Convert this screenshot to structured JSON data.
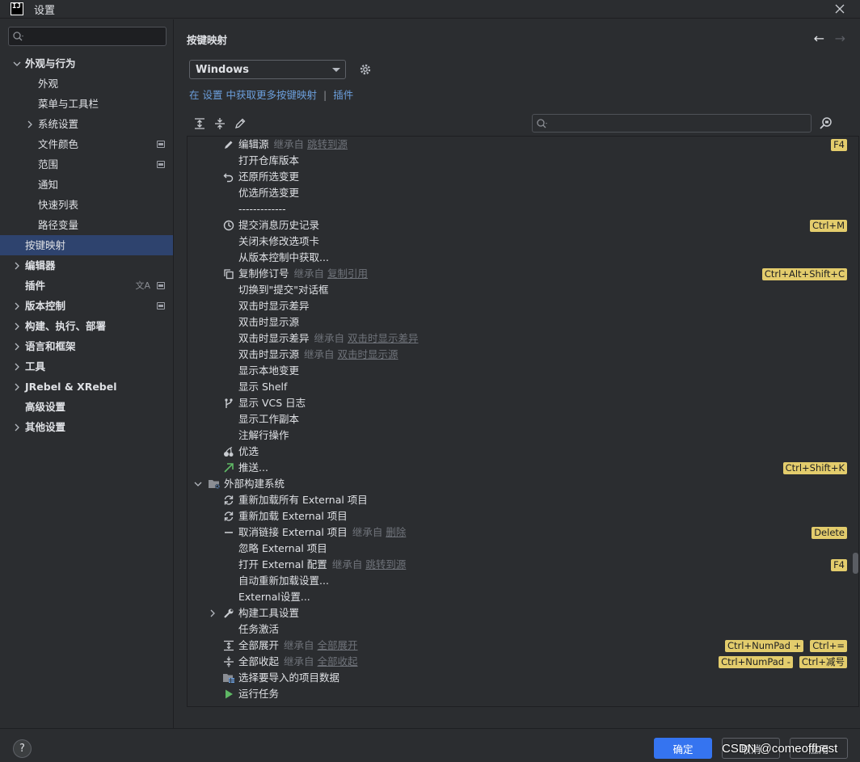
{
  "window": {
    "title": "设置",
    "logo": "IJ"
  },
  "sidebar": {
    "search_placeholder": "",
    "items": [
      {
        "label": "外观与行为"
      },
      {
        "label": "外观"
      },
      {
        "label": "菜单与工具栏"
      },
      {
        "label": "系统设置"
      },
      {
        "label": "文件颜色"
      },
      {
        "label": "范围"
      },
      {
        "label": "通知"
      },
      {
        "label": "快速列表"
      },
      {
        "label": "路径变量"
      },
      {
        "label": "按键映射"
      },
      {
        "label": "编辑器"
      },
      {
        "label": "插件"
      },
      {
        "label": "版本控制"
      },
      {
        "label": "构建、执行、部署"
      },
      {
        "label": "语言和框架"
      },
      {
        "label": "工具"
      },
      {
        "label": "JRebel & XRebel"
      },
      {
        "label": "高级设置"
      },
      {
        "label": "其他设置"
      }
    ]
  },
  "main": {
    "title": "按键映射",
    "keymap_selected": "Windows",
    "plugin_line": {
      "prefix": "在",
      "settings": "设置",
      "middle": "中获取更多按键映射",
      "separator": "|",
      "plugins": "插件"
    },
    "search_placeholder": ""
  },
  "actions": [
    {
      "label": "编辑源",
      "icon": "pencil-icon",
      "inherit": "继承自",
      "source": "跳转到源",
      "shortcuts": [
        "F4"
      ]
    },
    {
      "label": "打开仓库版本",
      "icon": "",
      "shortcuts": []
    },
    {
      "label": "还原所选变更",
      "icon": "undo-icon",
      "shortcuts": []
    },
    {
      "label": "优选所选变更",
      "icon": "",
      "shortcuts": []
    },
    {
      "label": "-------------",
      "icon": "",
      "shortcuts": []
    },
    {
      "label": "提交消息历史记录",
      "icon": "clock-icon",
      "shortcuts": [
        "Ctrl+M"
      ]
    },
    {
      "label": "关闭未修改选项卡",
      "icon": "",
      "shortcuts": []
    },
    {
      "label": "从版本控制中获取...",
      "icon": "",
      "shortcuts": []
    },
    {
      "label": "复制修订号",
      "icon": "copy-icon",
      "inherit": "继承自",
      "source": "复制引用",
      "shortcuts": [
        "Ctrl+Alt+Shift+C"
      ]
    },
    {
      "label": "切换到\"提交\"对话框",
      "icon": "",
      "shortcuts": []
    },
    {
      "label": "双击时显示差异",
      "icon": "",
      "shortcuts": []
    },
    {
      "label": "双击时显示源",
      "icon": "",
      "shortcuts": []
    },
    {
      "label": "双击时显示差异",
      "icon": "",
      "inherit": "继承自",
      "source": "双击时显示差异",
      "shortcuts": []
    },
    {
      "label": "双击时显示源",
      "icon": "",
      "inherit": "继承自",
      "source": "双击时显示源",
      "shortcuts": []
    },
    {
      "label": "显示本地变更",
      "icon": "",
      "shortcuts": []
    },
    {
      "label": "显示 Shelf",
      "icon": "",
      "shortcuts": []
    },
    {
      "label": "显示 VCS 日志",
      "icon": "branch-icon",
      "shortcuts": []
    },
    {
      "label": "显示工作副本",
      "icon": "",
      "shortcuts": []
    },
    {
      "label": "注解行操作",
      "icon": "",
      "shortcuts": []
    },
    {
      "label": "优选",
      "icon": "cherry-icon",
      "shortcuts": []
    },
    {
      "label": "推送...",
      "icon": "push-arrow-icon",
      "shortcuts": [
        "Ctrl+Shift+K"
      ]
    },
    {
      "label": "外部构建系统",
      "icon": "folder-gear-icon",
      "folder": true,
      "expanded": true,
      "shortcuts": []
    },
    {
      "label": "重新加载所有 External 项目",
      "icon": "refresh-icon",
      "shortcuts": []
    },
    {
      "label": "重新加载 External 项目",
      "icon": "refresh-icon",
      "shortcuts": []
    },
    {
      "label": "取消链接 External 项目",
      "icon": "minus-icon",
      "inherit": "继承自",
      "source": "删除",
      "shortcuts": [
        "Delete"
      ]
    },
    {
      "label": "忽略 External 项目",
      "icon": "",
      "shortcuts": []
    },
    {
      "label": "打开 External 配置",
      "icon": "",
      "inherit": "继承自",
      "source": "跳转到源",
      "shortcuts": [
        "F4"
      ]
    },
    {
      "label": "自动重新加载设置...",
      "icon": "",
      "shortcuts": []
    },
    {
      "label": "External设置...",
      "icon": "",
      "shortcuts": []
    },
    {
      "label": "构建工具设置",
      "icon": "wrench-icon",
      "collapsed": true,
      "shortcuts": []
    },
    {
      "label": "任务激活",
      "icon": "",
      "shortcuts": []
    },
    {
      "label": "全部展开",
      "icon": "expand-all-icon",
      "inherit": "继承自",
      "source": "全部展开",
      "shortcuts": [
        "Ctrl+NumPad +",
        "Ctrl+="
      ]
    },
    {
      "label": "全部收起",
      "icon": "collapse-all-icon",
      "inherit": "继承自",
      "source": "全部收起",
      "shortcuts": [
        "Ctrl+NumPad -",
        "Ctrl+减号"
      ]
    },
    {
      "label": "选择要导入的项目数据",
      "icon": "project-data-icon",
      "shortcuts": []
    },
    {
      "label": "运行任务",
      "icon": "run-icon",
      "shortcuts": []
    }
  ],
  "footer": {
    "help": "?",
    "ok": "确定",
    "cancel": "取消",
    "apply": "应用",
    "watermark": "CSDN @comeoffbest"
  },
  "colors": {
    "accent": "#3574f0",
    "selection": "#2e436e",
    "shortcut_bg": "#e3cc6c",
    "link": "#6c9fdc"
  }
}
